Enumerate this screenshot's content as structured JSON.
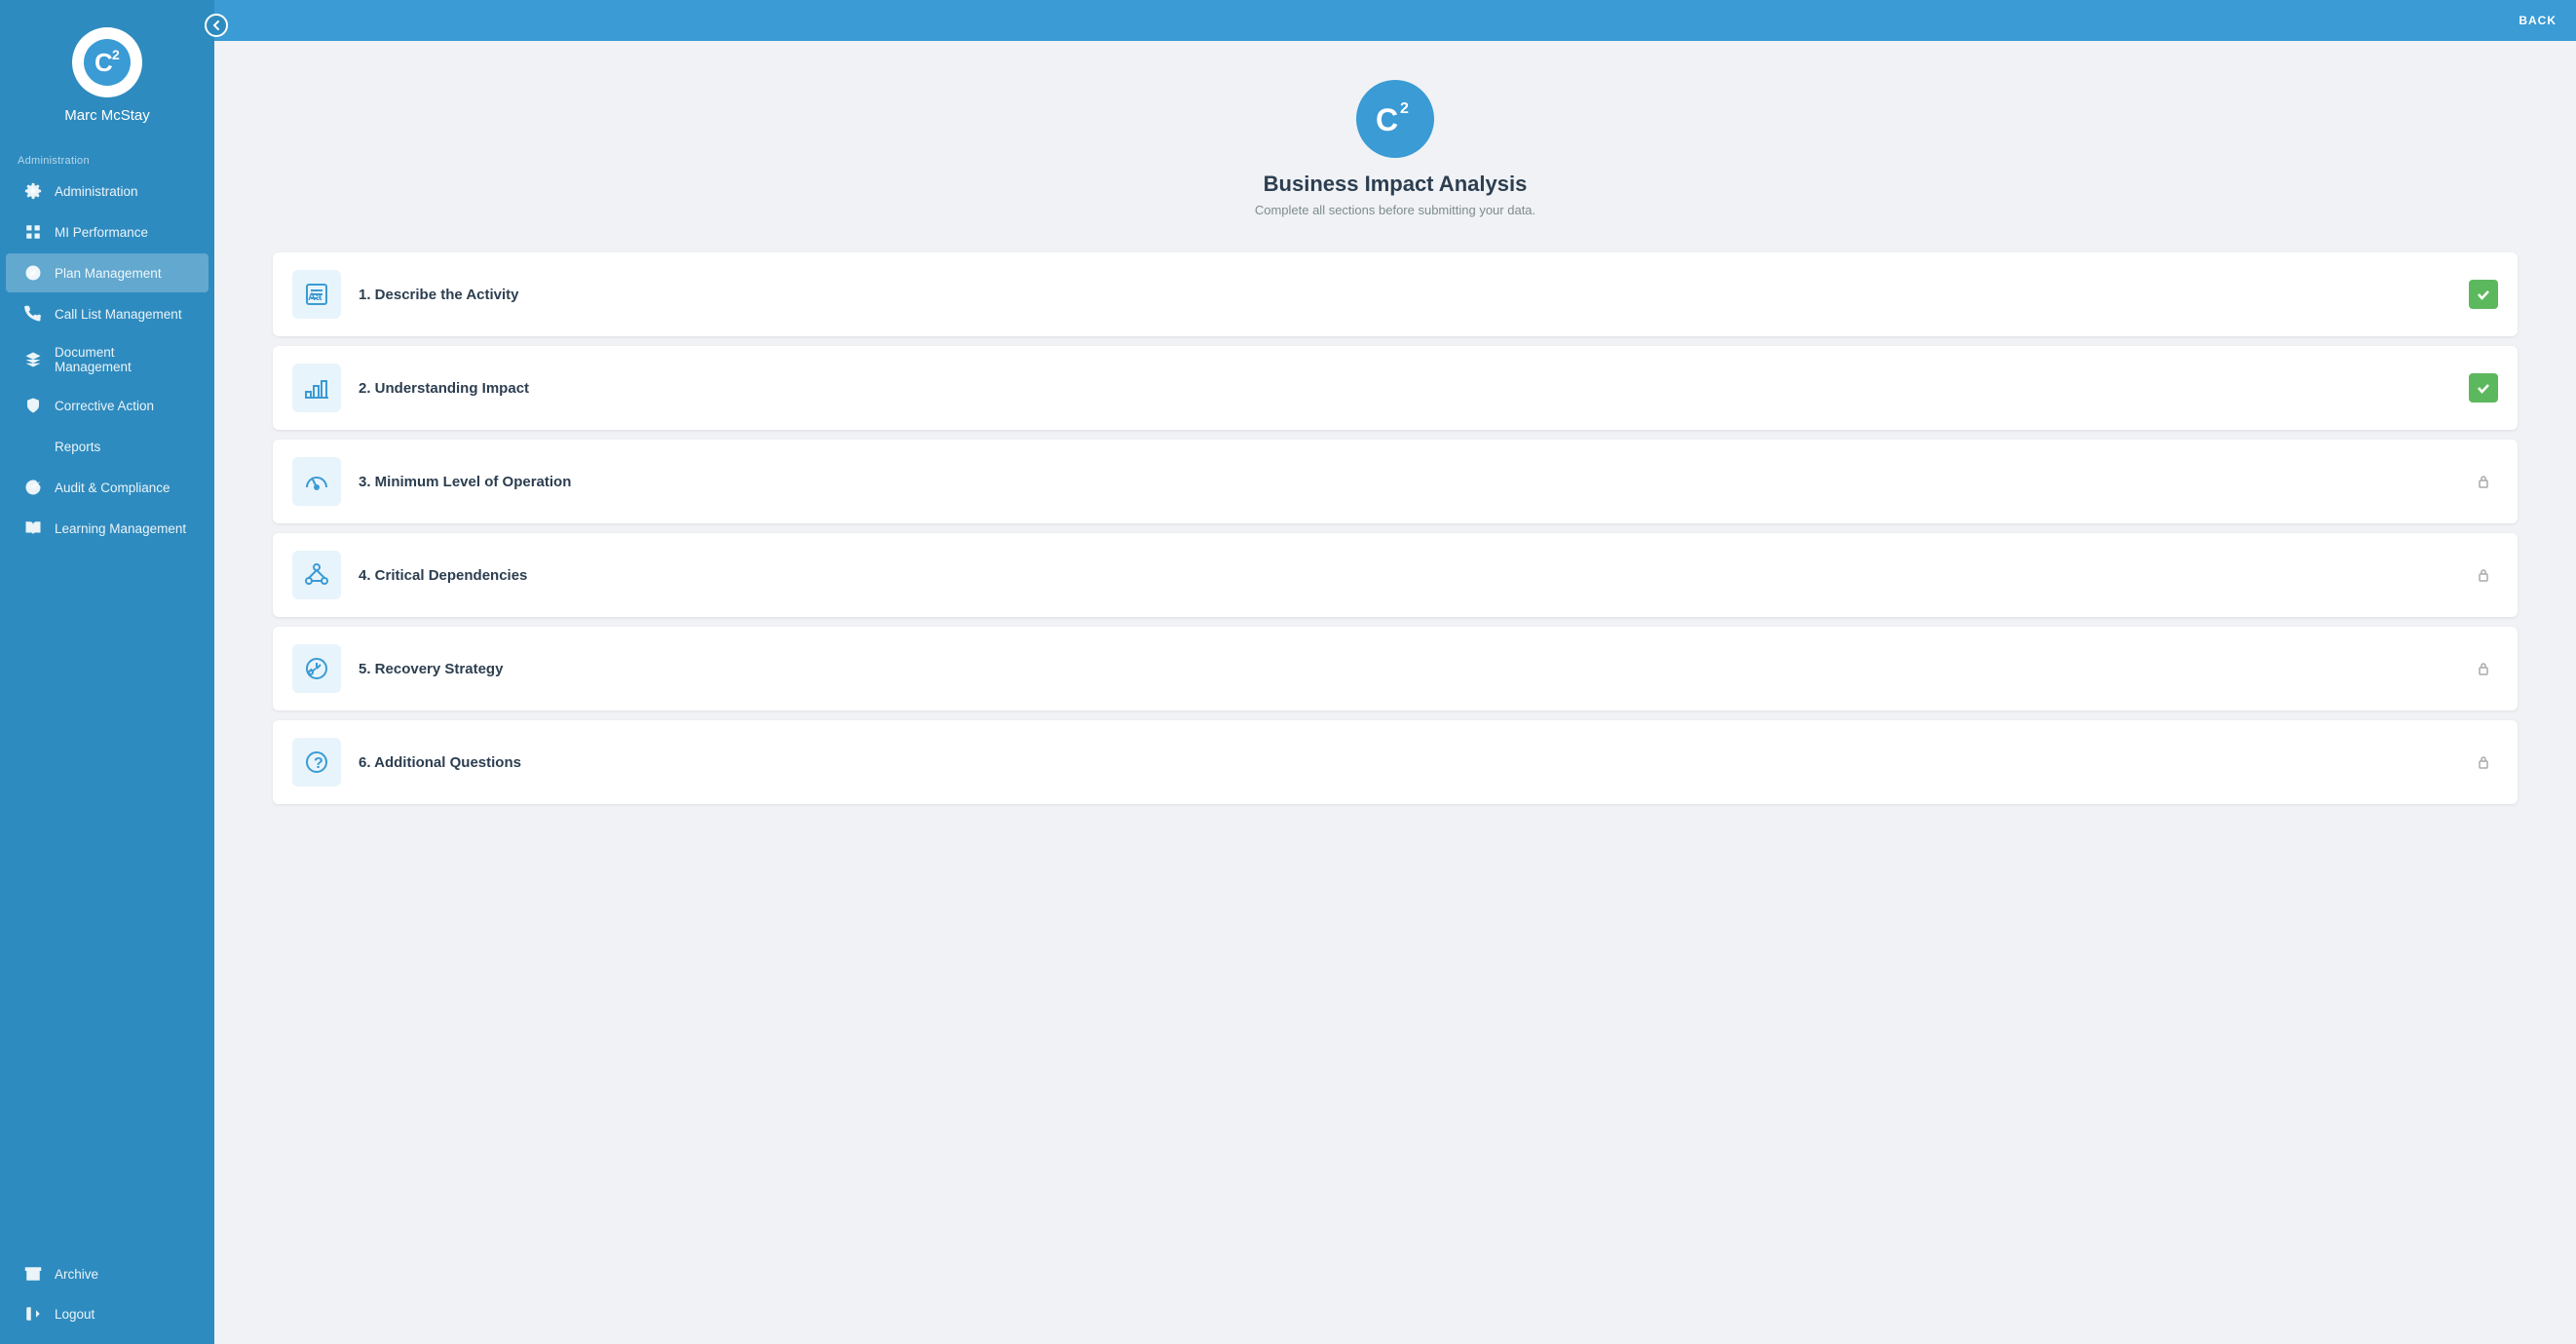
{
  "sidebar": {
    "logo_alt": "C2 Logo",
    "user_name": "Marc McStay",
    "section_label": "Administration",
    "nav_items": [
      {
        "id": "administration",
        "label": "Administration",
        "icon": "gear"
      },
      {
        "id": "mi-performance",
        "label": "MI Performance",
        "icon": "grid"
      },
      {
        "id": "plan-management",
        "label": "Plan Management",
        "icon": "compass",
        "active": true
      },
      {
        "id": "call-list-management",
        "label": "Call List Management",
        "icon": "phone"
      },
      {
        "id": "document-management",
        "label": "Document Management",
        "icon": "layers"
      },
      {
        "id": "corrective-action",
        "label": "Corrective Action",
        "icon": "shield"
      },
      {
        "id": "reports",
        "label": "Reports",
        "icon": "bar-chart"
      },
      {
        "id": "audit-compliance",
        "label": "Audit & Compliance",
        "icon": "check-circle"
      },
      {
        "id": "learning-management",
        "label": "Learning Management",
        "icon": "book"
      }
    ],
    "bottom_items": [
      {
        "id": "archive",
        "label": "Archive",
        "icon": "archive"
      },
      {
        "id": "logout",
        "label": "Logout",
        "icon": "sign-out"
      }
    ]
  },
  "topbar": {
    "back_label": "BACK"
  },
  "main": {
    "title": "Business Impact Analysis",
    "subtitle": "Complete all sections before submitting your data.",
    "sections": [
      {
        "id": "describe-activity",
        "number": "1.",
        "label": "Describe the Activity",
        "status": "complete",
        "icon": "text"
      },
      {
        "id": "understanding-impact",
        "number": "2.",
        "label": "Understanding Impact",
        "status": "complete",
        "icon": "chart"
      },
      {
        "id": "minimum-level",
        "number": "3.",
        "label": "Minimum Level of Operation",
        "status": "locked",
        "icon": "gauge"
      },
      {
        "id": "critical-dependencies",
        "number": "4.",
        "label": "Critical Dependencies",
        "status": "locked",
        "icon": "network"
      },
      {
        "id": "recovery-strategy",
        "number": "5.",
        "label": "Recovery Strategy",
        "status": "locked",
        "icon": "strategy"
      },
      {
        "id": "additional-questions",
        "number": "6.",
        "label": "Additional Questions",
        "status": "locked",
        "icon": "question"
      }
    ]
  }
}
